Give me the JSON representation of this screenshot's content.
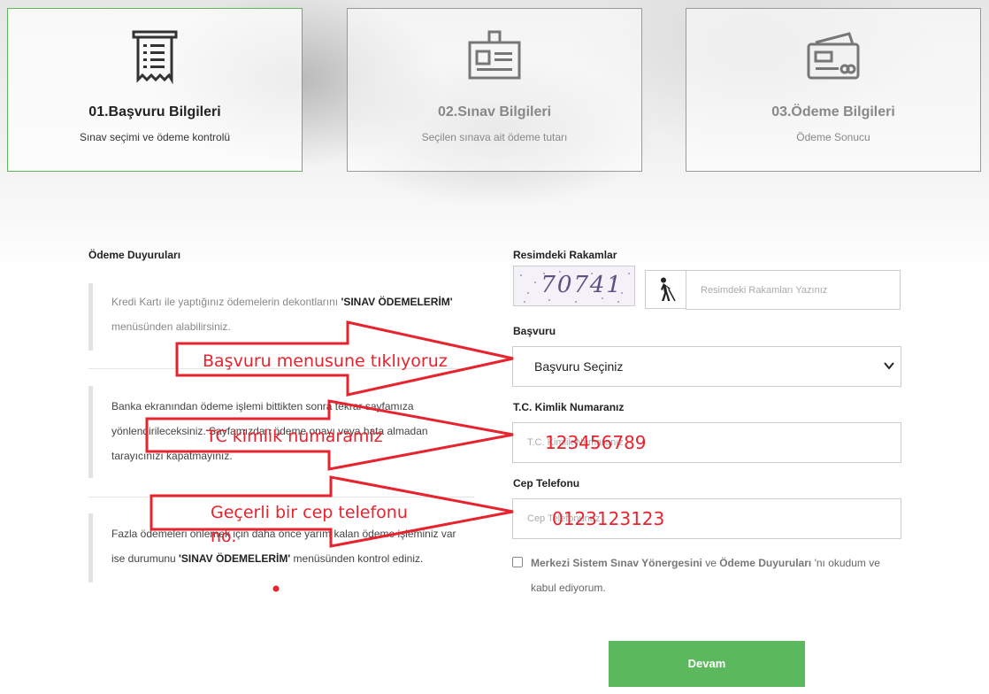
{
  "steps": [
    {
      "title": "01.Başvuru Bilgileri",
      "subtitle": "Sınav seçimi ve ödeme kontrolü",
      "icon": "receipt-icon",
      "state": "active"
    },
    {
      "title": "02.Sınav Bilgileri",
      "subtitle": "Seçilen sınava ait ödeme tutarı",
      "icon": "id-badge-icon",
      "state": "inactive"
    },
    {
      "title": "03.Ödeme Bilgileri",
      "subtitle": "Ödeme Sonucu",
      "icon": "credit-card-icon",
      "state": "inactive"
    }
  ],
  "announcements": {
    "heading": "Ödeme Duyuruları",
    "items": [
      {
        "before": "Kredi Kartı ile yaptığınız ödemelerin dekontlarını ",
        "bold": "'SINAV ÖDEMELERİM'",
        "after": " menüsünden alabilirsiniz."
      },
      {
        "before": "Banka ekranından ödeme işlemi bittikten sonra tekrar sayfamıza yönlendirileceksiniz. Sayfamızdan ödeme onayı veya hata almadan tarayıcınızı kapatmayınız.",
        "bold": "",
        "after": ""
      },
      {
        "before": "Fazla ödemeleri önlemek için daha önce yarım kalan ödeme işleminiz var ise durumunu ",
        "bold": "'SINAV ÖDEMELERİM'",
        "after": " menüsünden kontrol ediniz."
      }
    ]
  },
  "form": {
    "captcha": {
      "label": "Resimdeki Rakamlar",
      "image_text": "70741",
      "placeholder": "Resimdeki Rakamları Yazınız",
      "accessibility_icon": "blind-person-icon"
    },
    "application": {
      "label": "Başvuru",
      "selected": "Başvuru Seçiniz"
    },
    "tc": {
      "label": "T.C. Kimlik Numaranız",
      "placeholder": "T.C. Kimlik Numaranız"
    },
    "phone": {
      "label": "Cep Telefonu",
      "placeholder": "Cep Telefonunuz"
    },
    "agreement": {
      "bold1": "Merkezi Sistem Sınav Yönergesini",
      "mid": " ve ",
      "bold2": "Ödeme Duyuruları",
      "after": " 'nı okudum ve kabul ediyorum.",
      "checked": false
    },
    "submit": "Devam"
  },
  "annotations": {
    "arrow1": "Başvuru menusune tıklıyoruz",
    "arrow2": "TC kimlik numaramiz",
    "arrow2_value": "123456789",
    "arrow3_line1": "Geçerli bir cep telefonu",
    "arrow3_line2": "no.",
    "arrow3_value": "0123123123",
    "color": "#e8232d"
  },
  "colors": {
    "accent": "#5cb85c",
    "border": "#cccccc"
  }
}
